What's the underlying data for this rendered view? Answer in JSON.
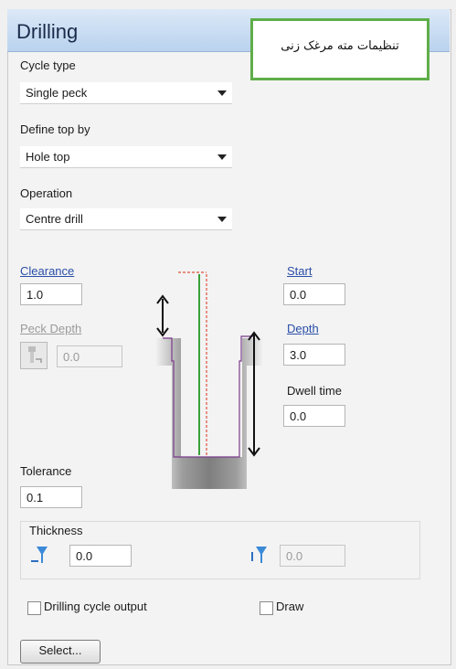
{
  "window": {
    "title": "Drilling"
  },
  "note": {
    "text": "تنظیمات مته مرغک زنی"
  },
  "cycle_type": {
    "label": "Cycle type",
    "value": "Single peck"
  },
  "define_top": {
    "label": "Define top by",
    "value": "Hole top"
  },
  "operation": {
    "label": "Operation",
    "value": "Centre drill"
  },
  "clearance": {
    "label": "Clearance",
    "value": "1.0"
  },
  "start": {
    "label": "Start",
    "value": "0.0"
  },
  "peck_depth": {
    "label": "Peck Depth",
    "value": "0.0"
  },
  "depth": {
    "label": "Depth",
    "value": "3.0"
  },
  "dwell_time": {
    "label": "Dwell time",
    "value": "0.0"
  },
  "tolerance": {
    "label": "Tolerance",
    "value": "0.1"
  },
  "thickness": {
    "label": "Thickness",
    "value": "0.0",
    "secondary_value": "0.0"
  },
  "drilling_cycle_output": {
    "label": "Drilling cycle output"
  },
  "draw": {
    "label": "Draw"
  },
  "select_button": {
    "label": "Select..."
  },
  "icons": [
    "drop-down-arrow-icon",
    "peck-tool-icon",
    "thickness-tool-icon",
    "thickness-secondary-icon"
  ]
}
